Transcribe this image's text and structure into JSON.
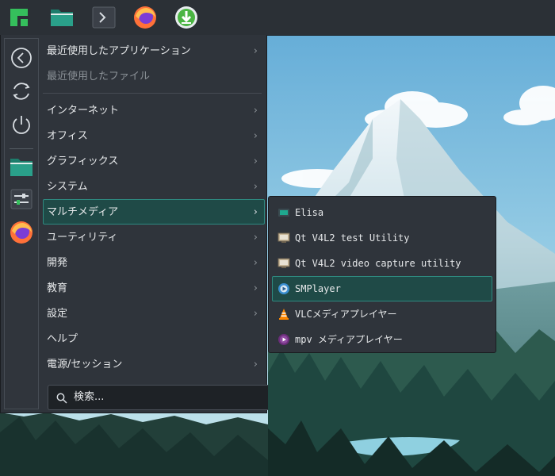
{
  "menu": {
    "items": [
      {
        "label": "最近使用したアプリケーション",
        "has_arrow": true
      },
      {
        "label": "最近使用したファイル",
        "has_arrow": false
      },
      {
        "label": "インターネット",
        "has_arrow": true
      },
      {
        "label": "オフィス",
        "has_arrow": true
      },
      {
        "label": "グラフィックス",
        "has_arrow": true
      },
      {
        "label": "システム",
        "has_arrow": true
      },
      {
        "label": "マルチメディア",
        "has_arrow": true
      },
      {
        "label": "ユーティリティ",
        "has_arrow": true
      },
      {
        "label": "開発",
        "has_arrow": true
      },
      {
        "label": "教育",
        "has_arrow": true
      },
      {
        "label": "設定",
        "has_arrow": true
      },
      {
        "label": "ヘルプ",
        "has_arrow": false
      },
      {
        "label": "電源/セッション",
        "has_arrow": true
      }
    ],
    "arrow_glyph": "›",
    "search_placeholder": "検索..."
  },
  "submenu": {
    "items": [
      {
        "label": "Elisa",
        "icon": "elisa-icon"
      },
      {
        "label": "Qt V4L2 test Utility",
        "icon": "qv4l2-icon"
      },
      {
        "label": "Qt V4L2 video capture utility",
        "icon": "qvidcap-icon"
      },
      {
        "label": "SMPlayer",
        "icon": "smplayer-icon"
      },
      {
        "label": "VLCメディアプレイヤー",
        "icon": "vlc-icon"
      },
      {
        "label": "mpv メディアプレイヤー",
        "icon": "mpv-icon"
      }
    ]
  },
  "colors": {
    "panel": "#2b3036",
    "menu_bg": "#2f343b",
    "highlight_bg": "#1f4a47",
    "highlight_border": "#2e8a80",
    "accent_green": "#35bf5c"
  }
}
